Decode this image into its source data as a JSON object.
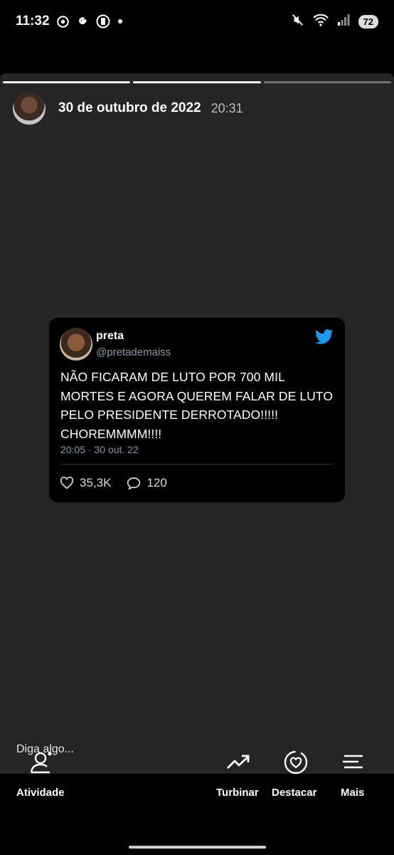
{
  "status": {
    "time": "11:32",
    "battery": "72"
  },
  "story": {
    "date": "30 de outubro de 2022",
    "time": "20:31",
    "progress_done": 2,
    "progress_total": 3
  },
  "tweet": {
    "name": "preta",
    "handle": "@pretademaiss",
    "text_lines": [
      "NÃO FICARAM DE LUTO POR 700 MIL",
      "MORTES E AGORA QUEREM FALAR DE LUTO",
      "PELO PRESIDENTE DERROTADO!!!!!",
      "CHOREMMMM!!!!"
    ],
    "meta": "20:05 · 30 out. 22",
    "likes": "35,3K",
    "replies": "120",
    "colors": {
      "bird": "#1d9bf0"
    }
  },
  "reply": {
    "placeholder": "Diga algo..."
  },
  "nav": {
    "activity": "Atividade",
    "boost": "Turbinar",
    "highlight": "Destacar",
    "more": "Mais"
  }
}
